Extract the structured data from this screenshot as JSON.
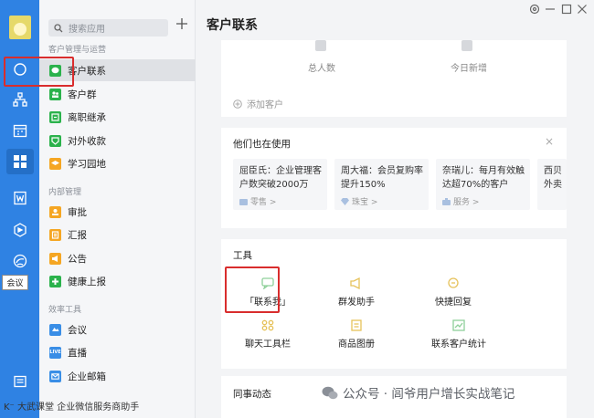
{
  "rail": {
    "icons": [
      "chat-icon",
      "org-icon",
      "calendar-icon",
      "apps-icon",
      "doc-icon",
      "cube-icon",
      "cloud-icon",
      "message-icon"
    ],
    "bottom_text": "K⁻  大武课堂  企业微信服务商助手"
  },
  "sidebar": {
    "search_placeholder": "搜索应用",
    "sections": [
      {
        "title": "客户管理与运营",
        "items": [
          {
            "label": "客户联系",
            "color": "#2bb24c",
            "selected": true
          },
          {
            "label": "客户群",
            "color": "#2bb24c"
          },
          {
            "label": "离职继承",
            "color": "#2bb24c"
          },
          {
            "label": "对外收款",
            "color": "#2bb24c"
          },
          {
            "label": "学习园地",
            "color": "#f5a623"
          }
        ]
      },
      {
        "title": "内部管理",
        "items": [
          {
            "label": "审批",
            "color": "#f5a623"
          },
          {
            "label": "汇报",
            "color": "#f5a623"
          },
          {
            "label": "公告",
            "color": "#f5a623"
          },
          {
            "label": "健康上报",
            "color": "#2bb24c"
          }
        ]
      },
      {
        "title": "效率工具",
        "items": [
          {
            "label": "会议",
            "color": "#3a8ee6"
          },
          {
            "label": "直播",
            "color": "#3a8ee6"
          },
          {
            "label": "企业邮箱",
            "color": "#3a8ee6"
          }
        ]
      }
    ],
    "tooltip": "会议"
  },
  "main": {
    "title": "客户联系",
    "stats": [
      {
        "label": "总人数"
      },
      {
        "label": "今日新增"
      }
    ],
    "add_customer": "添加客户",
    "using": {
      "title": "他们也在使用",
      "close": "×",
      "cases": [
        {
          "text": "屈臣氏：企业管理客户数突破2000万",
          "tag": "零售 >"
        },
        {
          "text": "周大福：会员复购率提升150%",
          "tag": "珠宝 >"
        },
        {
          "text": "奈瑞儿：每月有效触达超70%的客户",
          "tag": "服务 >"
        },
        {
          "text": "西贝外卖",
          "tag": ""
        }
      ]
    },
    "tools": {
      "title": "工具",
      "items": [
        {
          "label": "「联系我」",
          "icon": "contact-me-icon"
        },
        {
          "label": "群发助手",
          "icon": "broadcast-icon"
        },
        {
          "label": "快捷回复",
          "icon": "quick-reply-icon"
        },
        {
          "label": "聊天工具栏",
          "icon": "chat-toolbar-icon"
        },
        {
          "label": "商品图册",
          "icon": "catalog-icon"
        },
        {
          "label": "联系客户统计",
          "icon": "stats-icon"
        }
      ]
    },
    "dynamics": {
      "title": "同事动态"
    },
    "watermark": "公众号 · 闾爷用户增长实战笔记"
  },
  "colors": {
    "rail": "#2f82e3",
    "accent_green": "#2bb24c",
    "highlight": "#d92d2d"
  }
}
